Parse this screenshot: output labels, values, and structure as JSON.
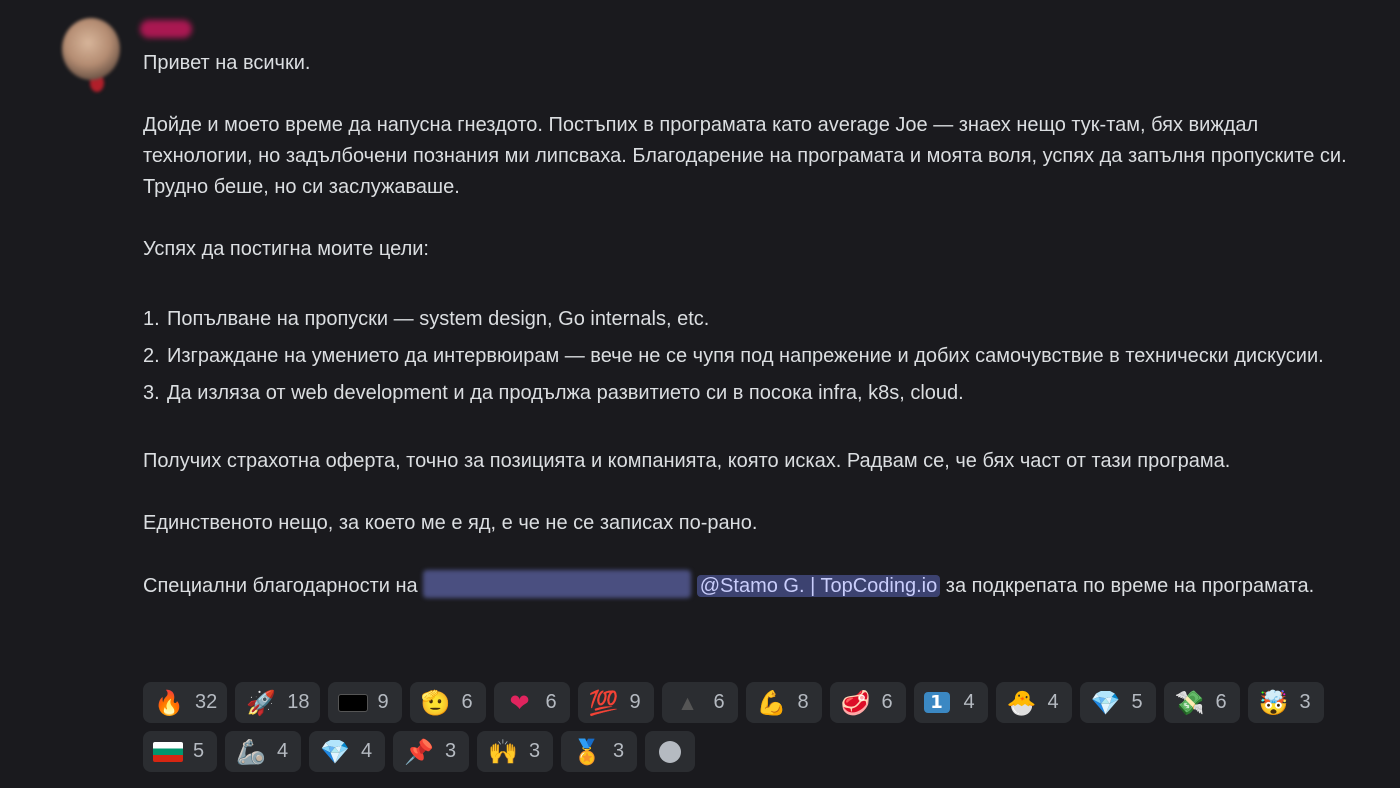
{
  "message": {
    "greeting": "Привет на всички.",
    "para1": "Дойде и моето време да напусна гнездото. Постъпих в програмата като average Joe — знаех нещо тук-там, бях виждал технологии, но задълбочени познания ми липсваха. Благодарение на програмата и моята воля, успях да запълня пропуските си. Трудно беше, но си заслужаваше.",
    "goals_intro": "Успях да постигна моите цели:",
    "goals": [
      {
        "num": "1.",
        "text": "Попълване на пропуски — system design, Go internals, etc."
      },
      {
        "num": "2.",
        "text": "Изграждане на умението да интервюирам — вече не се чупя под напрежение и добих самочувствие в технически дискусии."
      },
      {
        "num": "3.",
        "text": "Да изляза от web development и да продължа развитието си в посока infra, k8s, cloud."
      }
    ],
    "para2": "Получих страхотна оферта, точно за позицията и компанията, която исках. Радвам се, че бях част от тази програма.",
    "para3": "Единственото нещо, за което ме е яд, е че не се записах по-рано.",
    "thanks_prefix": "Специални благодарности на",
    "mention": "@Stamo G. | TopCoding.io",
    "thanks_suffix": "за подкрепата по време на програмата."
  },
  "reactions": [
    {
      "icon": "fire-icon",
      "glyph": "🔥",
      "count": "32"
    },
    {
      "icon": "rocket-icon",
      "glyph": "🚀",
      "count": "18"
    },
    {
      "icon": "topcoding-badge-icon",
      "glyph": "",
      "count": "9"
    },
    {
      "icon": "saluting-face-icon",
      "glyph": "🫡",
      "count": "6"
    },
    {
      "icon": "red-heart-icon",
      "glyph": "❤",
      "count": "6"
    },
    {
      "icon": "hundred-points-icon",
      "glyph": "💯",
      "count": "9"
    },
    {
      "icon": "top-logo-icon",
      "glyph": "▲",
      "count": "6"
    },
    {
      "icon": "flexed-biceps-light-icon",
      "glyph": "💪",
      "count": "8"
    },
    {
      "icon": "steak-icon",
      "glyph": "🥩",
      "count": "6"
    },
    {
      "icon": "keycap-one-icon",
      "glyph": "1",
      "count": "4"
    },
    {
      "icon": "hatching-chick-icon",
      "glyph": "🐣",
      "count": "4"
    },
    {
      "icon": "gem-stone-icon",
      "glyph": "💎",
      "count": "5"
    },
    {
      "icon": "money-with-wings-icon",
      "glyph": "💸",
      "count": "6"
    },
    {
      "icon": "exploding-head-icon",
      "glyph": "🤯",
      "count": "3"
    },
    {
      "icon": "bulgaria-flag-icon",
      "glyph": "",
      "count": "5"
    },
    {
      "icon": "mechanical-arm-icon",
      "glyph": "🦾",
      "count": "4"
    },
    {
      "icon": "blue-gem-icon",
      "glyph": "💎",
      "count": "4"
    },
    {
      "icon": "pushpin-icon",
      "glyph": "📌",
      "count": "3"
    },
    {
      "icon": "raising-hands-icon",
      "glyph": "🙌",
      "count": "3"
    },
    {
      "icon": "medal-icon",
      "glyph": "🏅",
      "count": "3"
    }
  ],
  "add_reaction_icon": "add-reaction-smiley-icon",
  "colors": {
    "background": "#1a1a1e",
    "text": "#dbdee1",
    "mention_bg": "#3c4270",
    "reaction_bg": "#2b2d31"
  }
}
